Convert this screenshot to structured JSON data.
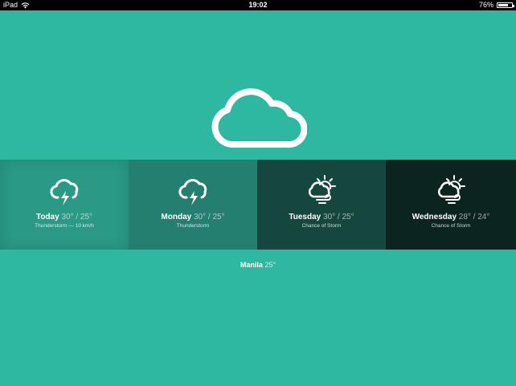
{
  "status_bar": {
    "device": "iPad",
    "time": "19:02",
    "battery": "76%",
    "battery_level": 0.76,
    "wifi_icon": "wifi-icon",
    "battery_icon": "battery-icon"
  },
  "current": {
    "icon": "cloud-icon"
  },
  "forecast": [
    {
      "name": "Today",
      "temps": "30° / 25°",
      "desc": "Thunderstorm — 10 km/h",
      "icon": "thunderstorm-icon"
    },
    {
      "name": "Monday",
      "temps": "30° / 25°",
      "desc": "Thunderstorm",
      "icon": "thunderstorm-icon"
    },
    {
      "name": "Tuesday",
      "temps": "30° / 25°",
      "desc": "Chance of Storm",
      "icon": "sun-cloud-wind-icon"
    },
    {
      "name": "Wednesday",
      "temps": "28° / 24°",
      "desc": "Chance of Storm",
      "icon": "sun-cloud-wind-icon"
    }
  ],
  "location": {
    "city": "Manila",
    "temp": "25°"
  },
  "colors": {
    "background": "#2fb8a1",
    "day_backgrounds": [
      "#2a9a87",
      "#257f70",
      "#16473f",
      "#0b2420"
    ]
  }
}
